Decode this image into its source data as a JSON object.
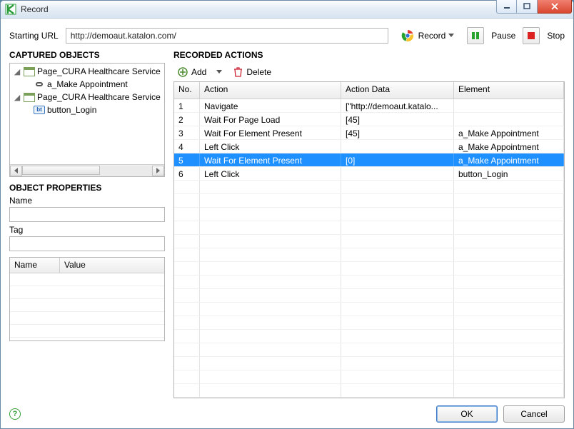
{
  "window": {
    "title": "Record"
  },
  "url_row": {
    "label": "Starting URL",
    "value": "http://demoaut.katalon.com/",
    "record": "Record",
    "pause": "Pause",
    "stop": "Stop"
  },
  "captured": {
    "title": "CAPTURED OBJECTS",
    "nodes": [
      {
        "label": "Page_CURA Healthcare Service",
        "child": {
          "type": "link",
          "label": "a_Make Appointment"
        }
      },
      {
        "label": "Page_CURA Healthcare Service",
        "child": {
          "type": "bt",
          "label": "button_Login"
        }
      }
    ]
  },
  "props": {
    "title": "OBJECT PROPERTIES",
    "name_label": "Name",
    "tag_label": "Tag",
    "table": {
      "col_name": "Name",
      "col_value": "Value"
    }
  },
  "recorded": {
    "title": "RECORDED ACTIONS",
    "add": "Add",
    "delete": "Delete",
    "cols": {
      "no": "No.",
      "action": "Action",
      "data": "Action Data",
      "element": "Element"
    },
    "rows": [
      {
        "no": "1",
        "action": "Navigate",
        "data": "[\"http://demoaut.katalo...",
        "element": ""
      },
      {
        "no": "2",
        "action": "Wait For Page Load",
        "data": "[45]",
        "element": ""
      },
      {
        "no": "3",
        "action": "Wait For Element Present",
        "data": "[45]",
        "element": "a_Make Appointment"
      },
      {
        "no": "4",
        "action": "Left Click",
        "data": "",
        "element": "a_Make Appointment"
      },
      {
        "no": "5",
        "action": "Wait For Element Present",
        "data": "[0]",
        "element": "a_Make Appointment",
        "selected": true
      },
      {
        "no": "6",
        "action": "Left Click",
        "data": "",
        "element": "button_Login"
      }
    ]
  },
  "footer": {
    "ok": "OK",
    "cancel": "Cancel"
  }
}
